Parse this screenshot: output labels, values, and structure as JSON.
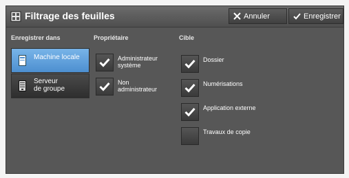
{
  "title": "Filtrage des feuilles",
  "toolbar": {
    "cancel_label": "Annuler",
    "save_label": "Enregistrer"
  },
  "save_in": {
    "heading": "Enregistrer dans",
    "options": [
      {
        "line1": "Machine locale",
        "line2": "",
        "selected": true
      },
      {
        "line1": "Serveur",
        "line2": "de groupe",
        "selected": false
      }
    ]
  },
  "owner": {
    "heading": "Propriétaire",
    "items": [
      {
        "line1": "Administrateur",
        "line2": "système",
        "checked": true
      },
      {
        "line1": "Non",
        "line2": "administrateur",
        "checked": true
      }
    ]
  },
  "target": {
    "heading": "Cible",
    "items": [
      {
        "label": "Dossier",
        "checked": true
      },
      {
        "label": "Numérisations",
        "checked": true
      },
      {
        "label": "Application externe",
        "checked": true
      },
      {
        "label": "Travaux de copie",
        "checked": false
      }
    ]
  },
  "colors": {
    "panel": "#575757",
    "accent": "#5b9ee0",
    "text": "#ffffff"
  },
  "icons": {
    "title": "sheet-filter-icon",
    "cancel": "x-icon",
    "save": "checkmark-icon",
    "local": "machine-icon",
    "server": "server-icon",
    "check": "checkmark-icon"
  }
}
